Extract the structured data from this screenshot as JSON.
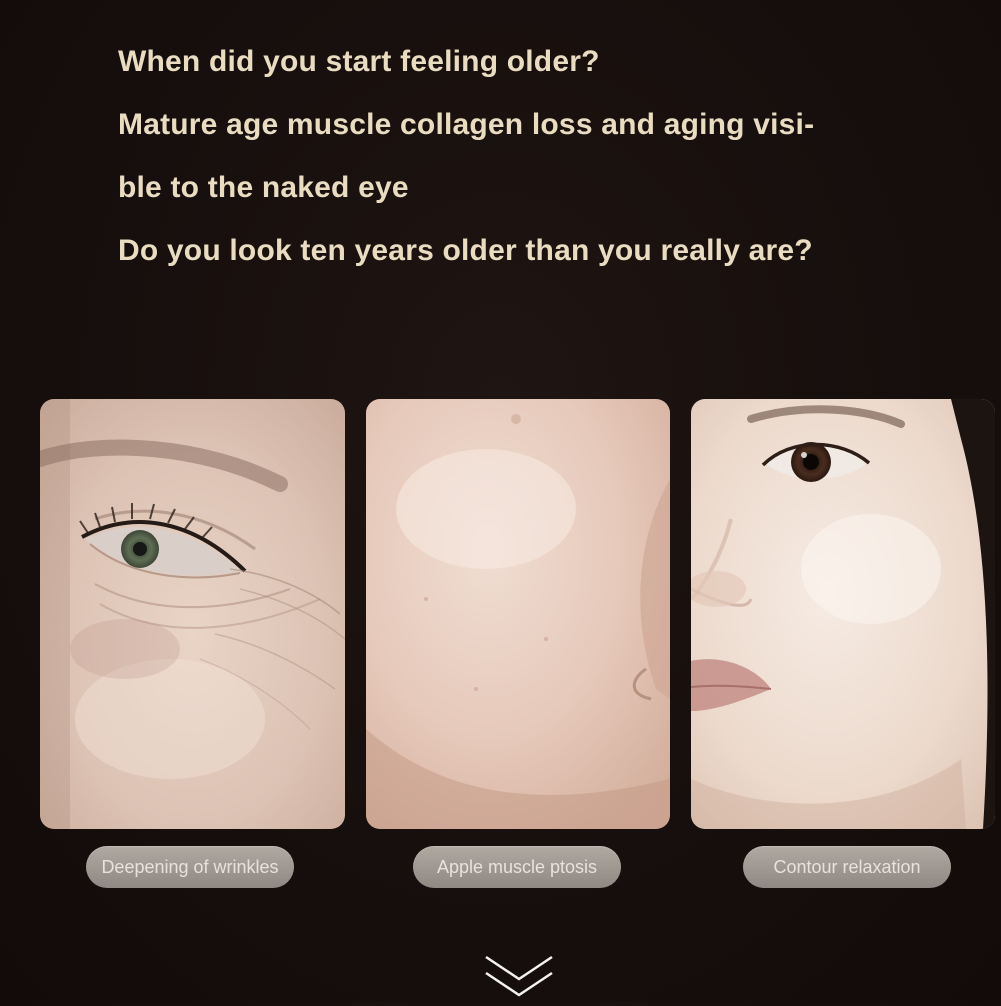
{
  "headline": {
    "line1": "When did you start feeling older?",
    "line2": "Mature age muscle collagen loss and aging visi-",
    "line3": "ble to the naked eye",
    "line4": "Do you look ten years older than you really are?"
  },
  "panels": [
    {
      "caption": "Deepening of wrinkles"
    },
    {
      "caption": "Apple muscle ptosis"
    },
    {
      "caption": "Contour relaxation"
    }
  ],
  "icons": {
    "scroll_indicator": "double-chevron-down-icon"
  },
  "colors": {
    "background": "#150e0c",
    "headline_text": "#e9dcc0",
    "pill_background": "#a29c96",
    "pill_text": "#e8e2dc"
  }
}
